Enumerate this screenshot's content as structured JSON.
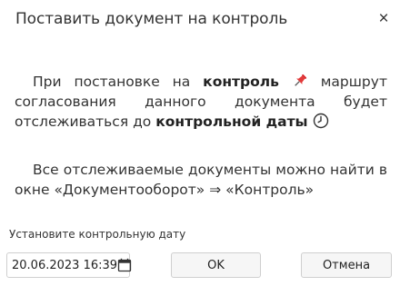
{
  "dialog": {
    "title": "Поставить документ на контроль",
    "close_label": "×"
  },
  "paragraph1": {
    "part1": "При постановке на ",
    "bold1": "контроль",
    "part2": " маршрут согласования данного документа будет отслеживаться до ",
    "bold2": "контрольной даты",
    "pin_icon": "pushpin-icon",
    "clock_icon": "clock-icon"
  },
  "paragraph2": {
    "text": "Все отслеживаемые документы можно найти в окне «Документооборот» ⇒ «Контроль»"
  },
  "date": {
    "label": "Установите контрольную дату",
    "value": "20.06.2023 16:39",
    "icon": "calendar-icon"
  },
  "buttons": {
    "ok": "OK",
    "cancel": "Отмена"
  },
  "colors": {
    "pin": "#d9262b",
    "text": "#333333",
    "border": "#cfcfcf"
  }
}
